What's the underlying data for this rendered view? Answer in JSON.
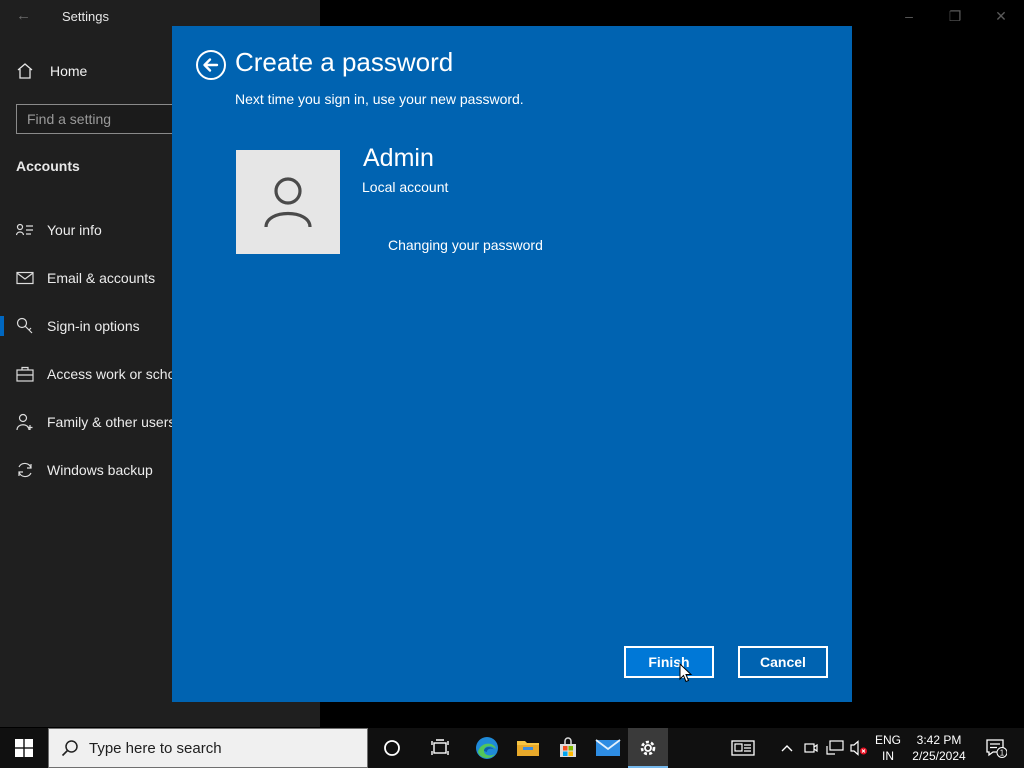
{
  "settings": {
    "title": "Settings",
    "home_label": "Home",
    "search_placeholder": "Find a setting",
    "section": "Accounts",
    "nav": [
      {
        "label": "Your info",
        "icon": "person-card-icon"
      },
      {
        "label": "Email & accounts",
        "icon": "mail-icon"
      },
      {
        "label": "Sign-in options",
        "icon": "key-icon"
      },
      {
        "label": "Access work or school",
        "icon": "briefcase-icon"
      },
      {
        "label": "Family & other users",
        "icon": "people-icon"
      },
      {
        "label": "Windows backup",
        "icon": "sync-icon"
      }
    ],
    "active_nav": "Sign-in options"
  },
  "dialog": {
    "title": "Create a password",
    "subtitle": "Next time you sign in, use your new password.",
    "account_name": "Admin",
    "account_type": "Local account",
    "status": "Changing your password",
    "finish_label": "Finish",
    "cancel_label": "Cancel",
    "background_color": "#0063b1"
  },
  "taskbar": {
    "search_placeholder": "Type here to search",
    "language_line1": "ENG",
    "language_line2": "IN",
    "time": "3:42 PM",
    "date": "2/25/2024",
    "notification_count": "1",
    "pinned": [
      "cortana-icon",
      "task-view-icon",
      "edge-icon",
      "file-explorer-icon",
      "store-icon",
      "mail-icon",
      "settings-icon"
    ]
  }
}
